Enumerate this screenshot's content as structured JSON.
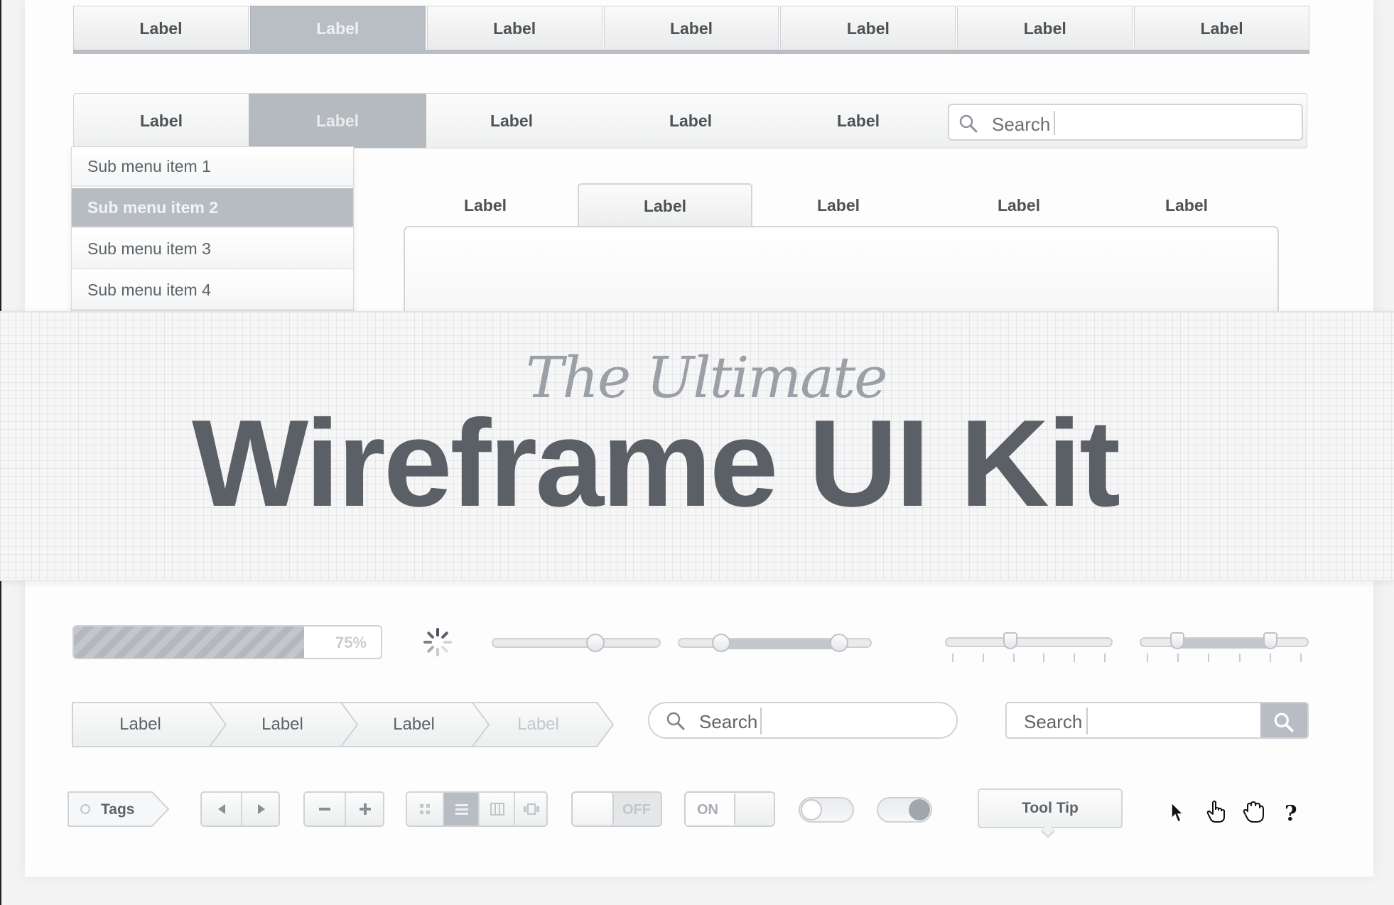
{
  "tab_bar_top": {
    "tabs": [
      "Label",
      "Label",
      "Label",
      "Label",
      "Label",
      "Label",
      "Label"
    ],
    "active_index": 1
  },
  "nav_bar": {
    "items": [
      "Label",
      "Label",
      "Label",
      "Label",
      "Label"
    ],
    "active_index": 1,
    "search_placeholder": "Search"
  },
  "dropdown": {
    "items": [
      "Sub menu item 1",
      "Sub menu item 2",
      "Sub menu item 3",
      "Sub menu item 4"
    ],
    "active_index": 1
  },
  "content_tabs": {
    "tabs": [
      "Label",
      "Label",
      "Label",
      "Label",
      "Label"
    ],
    "active_index": 1
  },
  "banner": {
    "script_title": "The Ultimate",
    "title": "Wireframe UI Kit"
  },
  "progress": {
    "value": 0.75,
    "label": "75%"
  },
  "sliders": [
    {
      "type": "single",
      "value": 0.62
    },
    {
      "type": "range",
      "values": [
        0.23,
        0.84
      ]
    },
    {
      "type": "single-ticked",
      "value": 0.4
    },
    {
      "type": "range-ticked",
      "values": [
        0.23,
        0.78
      ]
    }
  ],
  "breadcrumb": {
    "items": [
      "Label",
      "Label",
      "Label",
      "Label"
    ],
    "disabled_index": 3
  },
  "search_rounded": {
    "placeholder": "Search"
  },
  "search_button": {
    "placeholder": "Search"
  },
  "bottom_row": {
    "tag_label": "Tags",
    "toggle_off_label": "OFF",
    "toggle_on_label": "ON",
    "tooltip_label": "Tool Tip",
    "cursor_icons": [
      "arrow-cursor-icon",
      "pointer-hand-icon",
      "grab-hand-icon",
      "help-cursor-icon"
    ],
    "help_glyph": "?"
  },
  "colors": {
    "active_fill": "#b9bec4",
    "text_dark": "#4d5257",
    "title_dark": "#5b6066",
    "border": "#d0d3d6"
  }
}
